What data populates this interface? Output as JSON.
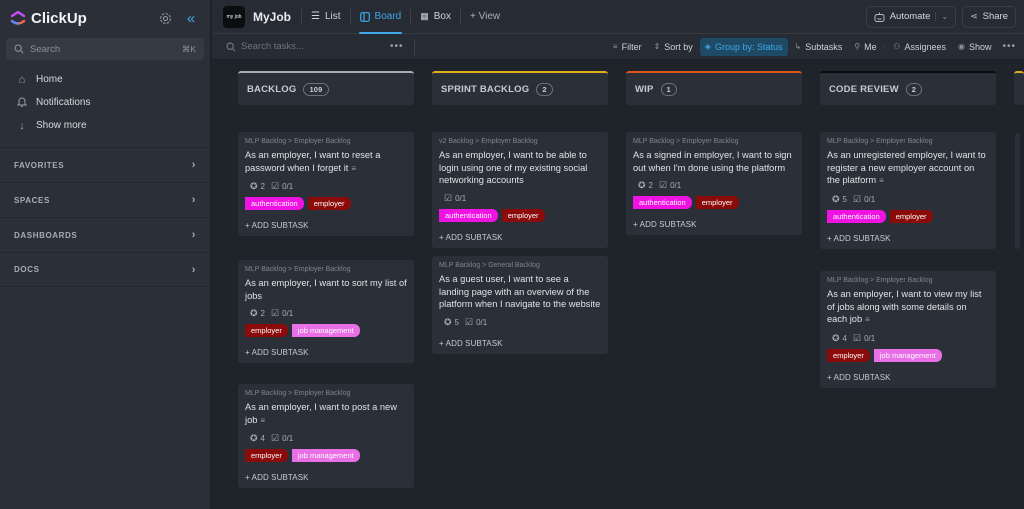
{
  "app": {
    "name": "ClickUp"
  },
  "sidebar": {
    "search": {
      "placeholder": "Search",
      "shortcut": "⌘K"
    },
    "nav": [
      {
        "label": "Home",
        "icon": "home-icon"
      },
      {
        "label": "Notifications",
        "icon": "bell-icon"
      },
      {
        "label": "Show more",
        "icon": "arrow-down-icon"
      }
    ],
    "sections": [
      {
        "label": "FAVORITES"
      },
      {
        "label": "SPACES"
      },
      {
        "label": "DASHBOARDS"
      },
      {
        "label": "DOCS"
      }
    ]
  },
  "header": {
    "workspace_icon_text": "my job",
    "workspace_name": "MyJob",
    "views": [
      {
        "label": "List",
        "active": false
      },
      {
        "label": "Board",
        "active": true
      },
      {
        "label": "Box",
        "active": false
      }
    ],
    "add_view_label": "+ View",
    "automate_label": "Automate",
    "share_label": "Share"
  },
  "toolbar": {
    "search_placeholder": "Search tasks...",
    "filter_label": "Filter",
    "sort_label": "Sort by",
    "group_label": "Group by: Status",
    "subtasks_label": "Subtasks",
    "me_label": "Me",
    "assignees_label": "Assignees",
    "show_label": "Show"
  },
  "colors": {
    "accent": "#3ea8e8",
    "tag_authentication": "#ee13e3",
    "tag_employer": "#8b0a0a",
    "tag_job_management": "#e86fe6",
    "status_backlog": "#a8adb4",
    "status_sprint_backlog": "#e2b11a",
    "status_wip": "#e0531f",
    "status_code_review": "#0a0b0d"
  },
  "board": {
    "add_subtask_label": "+ ADD SUBTASK",
    "columns": [
      {
        "name": "BACKLOG",
        "count": "109",
        "color": "#a8adb4",
        "cards": [
          {
            "crumb": "MLP Backlog > Employer Backlog",
            "title": "As an employer, I want to reset a password when I forget it",
            "has_desc": true,
            "points": "2",
            "checklist": "0/1",
            "tags": [
              "authentication",
              "employer"
            ]
          },
          {
            "crumb": "MLP Backlog > Employer Backlog",
            "title": "As an employer, I want to sort my list of jobs",
            "has_desc": false,
            "points": "2",
            "checklist": "0/1",
            "tags": [
              "employer",
              "job management"
            ]
          },
          {
            "crumb": "MLP Backlog > Employer Backlog",
            "title": "As an employer, I want to post a new job",
            "has_desc": true,
            "points": "4",
            "checklist": "0/1",
            "tags": [
              "employer",
              "job management"
            ]
          }
        ]
      },
      {
        "name": "SPRINT BACKLOG",
        "count": "2",
        "color": "#e2b11a",
        "cards": [
          {
            "crumb": "v2 Backlog > Employer Backlog",
            "title": "As an employer, I want to be able to login using one of my existing social networking accounts",
            "has_desc": false,
            "points": "",
            "checklist": "0/1",
            "tags": [
              "authentication",
              "employer"
            ]
          },
          {
            "crumb": "MLP Backlog > General Backlog",
            "title": "As a guest user, I want to see a landing page with an overview of the platform when I navigate to the website",
            "has_desc": false,
            "points": "5",
            "checklist": "0/1",
            "tags": []
          }
        ]
      },
      {
        "name": "WIP",
        "count": "1",
        "color": "#e0531f",
        "cards": [
          {
            "crumb": "MLP Backlog > Employer Backlog",
            "title": "As a signed in employer, I want to sign out when I'm done using the platform",
            "has_desc": false,
            "points": "2",
            "checklist": "0/1",
            "tags": [
              "authentication",
              "employer"
            ]
          }
        ]
      },
      {
        "name": "CODE REVIEW",
        "count": "2",
        "color": "#0a0b0d",
        "cards": [
          {
            "crumb": "MLP Backlog > Employer Backlog",
            "title": "As an unregistered employer, I want to register a new employer account on the platform",
            "has_desc": true,
            "points": "5",
            "checklist": "0/1",
            "tags": [
              "authentication",
              "employer"
            ]
          },
          {
            "crumb": "MLP Backlog > Employer Backlog",
            "title": "As an employer, I want to view my list of jobs along with some details on each job",
            "has_desc": true,
            "points": "4",
            "checklist": "0/1",
            "tags": [
              "employer",
              "job management"
            ]
          }
        ]
      }
    ]
  }
}
